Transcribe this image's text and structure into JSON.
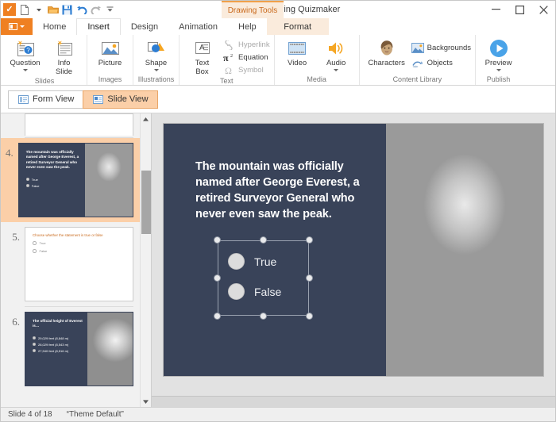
{
  "window": {
    "title": "Everest - iSpring Quizmaker",
    "app_icon": "ispring-check-icon",
    "minimize": "–",
    "maximize": "□",
    "close": "✕"
  },
  "quick_access": [
    {
      "name": "new-document-icon",
      "label": "New"
    },
    {
      "name": "new-dropdown-icon",
      "label": "New options"
    },
    {
      "name": "open-folder-icon",
      "label": "Open"
    },
    {
      "name": "save-icon",
      "label": "Save"
    },
    {
      "name": "undo-icon",
      "label": "Undo"
    },
    {
      "name": "redo-icon",
      "label": "Redo"
    },
    {
      "name": "customize-qat-icon",
      "label": "Customize Quick Access Toolbar"
    }
  ],
  "context_tab": {
    "label": "Drawing Tools",
    "accent": "#ef8022",
    "bg": "#faebdc"
  },
  "tabs": [
    {
      "label": "Home",
      "active": false
    },
    {
      "label": "Insert",
      "active": true
    },
    {
      "label": "Design",
      "active": false
    },
    {
      "label": "Animation",
      "active": false
    },
    {
      "label": "Help",
      "active": false
    },
    {
      "label": "Format",
      "active": false,
      "contextual": true
    }
  ],
  "ribbon": {
    "groups": [
      {
        "label": "Slides",
        "buttons": [
          {
            "label_line1": "Question",
            "label_line2": "",
            "icon": "question-slide-icon",
            "dropdown": true
          },
          {
            "label_line1": "Info",
            "label_line2": "Slide",
            "icon": "info-slide-icon",
            "dropdown": false
          }
        ]
      },
      {
        "label": "Images",
        "buttons": [
          {
            "label_line1": "Picture",
            "label_line2": "",
            "icon": "picture-icon",
            "dropdown": false
          }
        ]
      },
      {
        "label": "Illustrations",
        "buttons": [
          {
            "label_line1": "Shape",
            "label_line2": "",
            "icon": "shape-icon",
            "dropdown": true
          }
        ]
      },
      {
        "label": "Text",
        "buttons": [
          {
            "label_line1": "Text",
            "label_line2": "Box",
            "icon": "text-box-icon",
            "dropdown": false
          }
        ],
        "small_buttons": [
          {
            "label": "Hyperlink",
            "icon": "hyperlink-icon",
            "disabled": true
          },
          {
            "label": "Equation",
            "icon": "equation-icon",
            "disabled": false
          },
          {
            "label": "Symbol",
            "icon": "symbol-icon",
            "disabled": true
          }
        ]
      },
      {
        "label": "Media",
        "buttons": [
          {
            "label_line1": "Video",
            "label_line2": "",
            "icon": "video-icon",
            "dropdown": false
          },
          {
            "label_line1": "Audio",
            "label_line2": "",
            "icon": "audio-icon",
            "dropdown": true
          }
        ]
      },
      {
        "label": "Content Library",
        "buttons": [
          {
            "label_line1": "Characters",
            "label_line2": "",
            "icon": "characters-icon",
            "dropdown": false
          }
        ],
        "small_buttons": [
          {
            "label": "Backgrounds",
            "icon": "backgrounds-icon",
            "disabled": false
          },
          {
            "label": "Objects",
            "icon": "objects-icon",
            "disabled": false
          }
        ]
      },
      {
        "label": "Publish",
        "buttons": [
          {
            "label_line1": "Preview",
            "label_line2": "",
            "icon": "preview-play-icon",
            "dropdown": true
          }
        ]
      }
    ]
  },
  "view_toggle": {
    "form_view": {
      "label": "Form View",
      "icon": "form-view-icon",
      "active": false
    },
    "slide_view": {
      "label": "Slide View",
      "icon": "slide-view-icon",
      "active": true
    }
  },
  "thumbnails": {
    "partial_top": {
      "number": "",
      "type": "form"
    },
    "items": [
      {
        "number": "4.",
        "selected": true,
        "type": "slide",
        "title": "The mountain was officially named after George Everest, a retired Surveyor General who never even saw the peak.",
        "options": [
          "True",
          "False"
        ],
        "photo": "man"
      },
      {
        "number": "5.",
        "selected": false,
        "type": "form",
        "question": "Choose whether the statement is true or false",
        "options": [
          "True",
          "False"
        ]
      },
      {
        "number": "6.",
        "selected": false,
        "type": "slide",
        "title": "The official height of Everest is…",
        "options": [
          "29,029 feet (8,848 m)",
          "28,029 feet (8,543 m)",
          "27,940 feet (8,516 m)"
        ],
        "photo": "mountain"
      }
    ],
    "scrollbar": {
      "up_arrow": "▲",
      "down_arrow": "▼"
    }
  },
  "canvas": {
    "slide": {
      "title": "The mountain was officially named after George Everest, a retired Surveyor General who never even saw the peak.",
      "background_color": "#394359",
      "options": [
        "True",
        "False"
      ],
      "selection": {
        "handles": 8,
        "selected": true
      },
      "photo": "mountaineer-portrait"
    }
  },
  "status_bar": {
    "slide_counter": "Slide 4 of 18",
    "theme": "“Theme Default”"
  }
}
